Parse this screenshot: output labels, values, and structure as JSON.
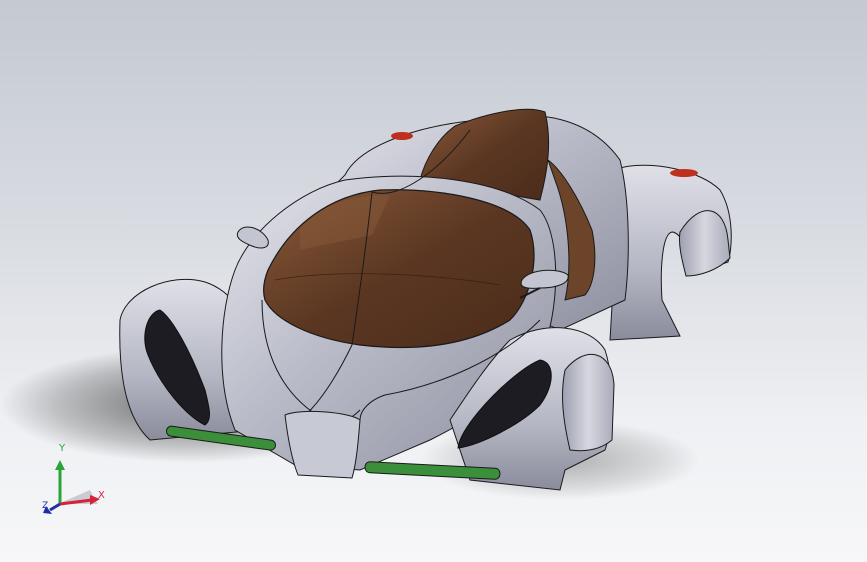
{
  "viewport": {
    "model_name": "concept-sports-car",
    "background_top": "#c4c9d2",
    "background_bottom": "#f7f7f9"
  },
  "colors": {
    "body": "#b9bbc8",
    "body_highlight": "#e4e5ec",
    "body_shadow": "#8e90a0",
    "glass": "#5b3722",
    "glass_highlight": "#8a5a3a",
    "intake": "#1c1c22",
    "drl": "#3b8f3a",
    "tail_light": "#c0301e",
    "edge": "#1a1a1a"
  },
  "triad": {
    "x_label": "X",
    "y_label": "Y",
    "z_label": "Z",
    "x_color": "#d4233a",
    "y_color": "#2aa339",
    "z_color": "#1e2fa8",
    "icon": "coordinate-triad-icon"
  }
}
